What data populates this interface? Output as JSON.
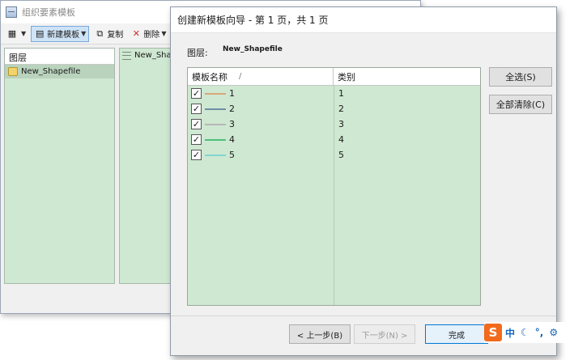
{
  "background_window": {
    "title": "组织要素模板",
    "toolbar": {
      "new_template_label": "新建模板",
      "copy_label": "复制",
      "delete_label": "删除"
    },
    "tree_header": "图层",
    "tree_item": "New_Shapefile",
    "list_item": "New_Shap"
  },
  "wizard": {
    "title": "创建新模板向导 - 第 1 页，共 1 页",
    "layer_label": "图层:",
    "layer_value": "New_Shapefile",
    "columns": {
      "name": "模板名称",
      "sort_indicator": "/",
      "category": "类别"
    },
    "rows": [
      {
        "name": "1",
        "category": "1",
        "checked": true,
        "color": "#d9a77a"
      },
      {
        "name": "2",
        "category": "2",
        "checked": true,
        "color": "#6e8fa8"
      },
      {
        "name": "3",
        "category": "3",
        "checked": true,
        "color": "#b7b7b7"
      },
      {
        "name": "4",
        "category": "4",
        "checked": true,
        "color": "#4fc07a"
      },
      {
        "name": "5",
        "category": "5",
        "checked": true,
        "color": "#7fd6d2"
      }
    ],
    "select_all_label": "全选(S)",
    "clear_all_label": "全部清除(C)",
    "back_label": "< 上一步(B)",
    "next_label": "下一步(N) >",
    "finish_label": "完成"
  },
  "ime": {
    "logo": "S",
    "lang": "中"
  },
  "colors": {
    "panel_green": "#cfe8d2",
    "selected_green": "#b9d3bd",
    "accent_blue": "#0078d7",
    "ime_orange": "#f26a1b"
  }
}
